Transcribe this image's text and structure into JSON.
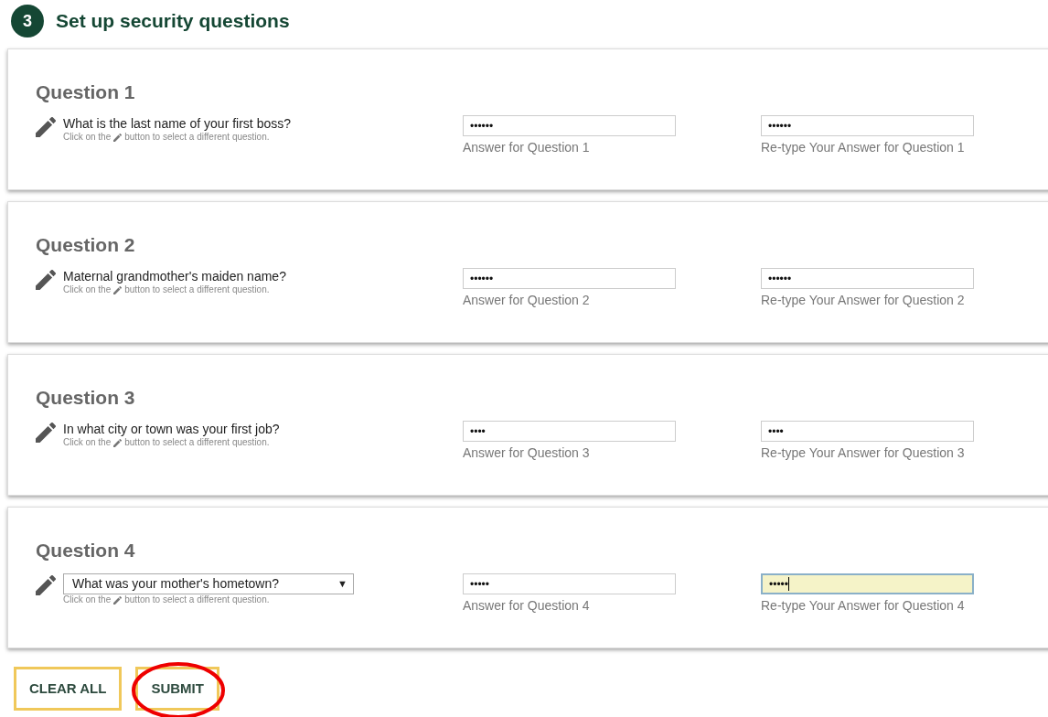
{
  "step": {
    "number": "3",
    "title": "Set up security questions"
  },
  "questions": [
    {
      "heading": "Question 1",
      "kind": "text",
      "question": "What is the last name of your first boss?",
      "hint_before": "Click on the",
      "hint_after": "button to select a different question.",
      "answer": "••••••",
      "answer_label": "Answer for Question 1",
      "retype": "••••••",
      "retype_label": "Re-type Your Answer for Question 1",
      "retype_focused": false
    },
    {
      "heading": "Question 2",
      "kind": "text",
      "question": "Maternal grandmother's maiden name?",
      "hint_before": "Click on the",
      "hint_after": "button to select a different question.",
      "answer": "••••••",
      "answer_label": "Answer for Question 2",
      "retype": "••••••",
      "retype_label": "Re-type Your Answer for Question 2",
      "retype_focused": false
    },
    {
      "heading": "Question 3",
      "kind": "text",
      "question": "In what city or town was your first job?",
      "hint_before": "Click on the",
      "hint_after": "button to select a different question.",
      "answer": "••••",
      "answer_label": "Answer for Question 3",
      "retype": "••••",
      "retype_label": "Re-type Your Answer for Question 3",
      "retype_focused": false
    },
    {
      "heading": "Question 4",
      "kind": "select",
      "question": "What was your mother's hometown?",
      "caret": "▼",
      "hint_before": "Click on the",
      "hint_after": "button to select a different question.",
      "answer": "•••••",
      "answer_label": "Answer for Question 4",
      "retype": "•••••",
      "retype_label": "Re-type Your Answer for Question 4",
      "retype_focused": true
    }
  ],
  "buttons": [
    {
      "label": "CLEAR ALL",
      "circled": false
    },
    {
      "label": "SUBMIT",
      "circled": true
    }
  ]
}
